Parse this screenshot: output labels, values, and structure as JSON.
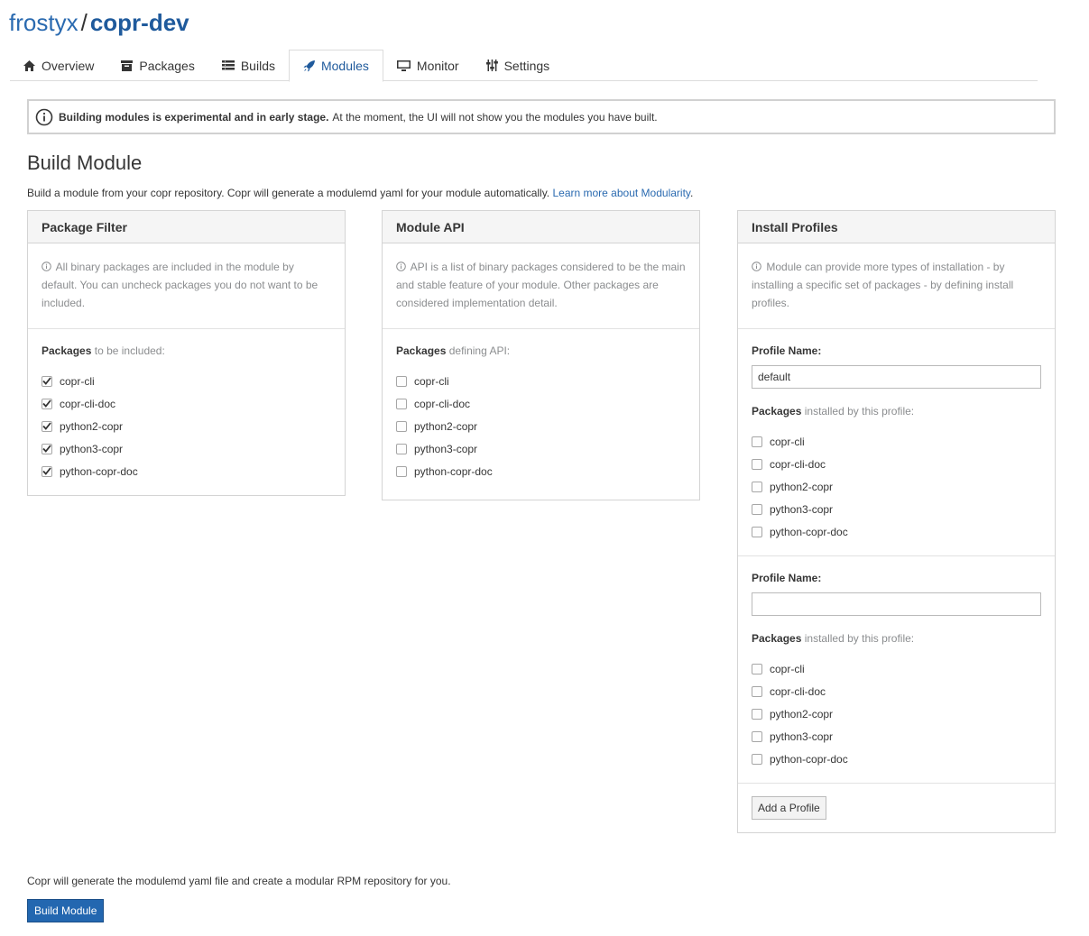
{
  "header": {
    "owner": "frostyx",
    "separator": "/",
    "project": "copr-dev"
  },
  "tabs": [
    {
      "label": "Overview",
      "icon": "home-icon"
    },
    {
      "label": "Packages",
      "icon": "archive-icon"
    },
    {
      "label": "Builds",
      "icon": "list-icon"
    },
    {
      "label": "Modules",
      "icon": "rocket-icon",
      "active": true
    },
    {
      "label": "Monitor",
      "icon": "monitor-icon"
    },
    {
      "label": "Settings",
      "icon": "sliders-icon"
    }
  ],
  "alert": {
    "bold": "Building modules is experimental and in early stage.",
    "text": "At the moment, the UI will not show you the modules you have built."
  },
  "page": {
    "title": "Build Module",
    "intro": "Build a module from your copr repository. Copr will generate a modulemd yaml for your module automatically.",
    "intro_link": "Learn more about Modularity",
    "intro_end": "."
  },
  "filter": {
    "title": "Package Filter",
    "desc": "All binary packages are included in the module by default. You can uncheck packages you do not want to be included.",
    "label_bold": "Packages",
    "label_rest": "to be included:",
    "packages": [
      "copr-cli",
      "copr-cli-doc",
      "python2-copr",
      "python3-copr",
      "python-copr-doc"
    ]
  },
  "api": {
    "title": "Module API",
    "desc": "API is a list of binary packages considered to be the main and stable feature of your module. Other packages are considered implementation detail.",
    "label_bold": "Packages",
    "label_rest": "defining API:",
    "packages": [
      "copr-cli",
      "copr-cli-doc",
      "python2-copr",
      "python3-copr",
      "python-copr-doc"
    ]
  },
  "profiles": {
    "title": "Install Profiles",
    "desc": "Module can provide more types of installation - by installing a specific set of packages - by defining install profiles.",
    "name_label": "Profile Name:",
    "label_bold": "Packages",
    "label_rest": "installed by this profile:",
    "profile1_name": "default",
    "profile2_name": "",
    "packages": [
      "copr-cli",
      "copr-cli-doc",
      "python2-copr",
      "python3-copr",
      "python-copr-doc"
    ],
    "add_button": "Add a Profile"
  },
  "footer": {
    "text": "Copr will generate the modulemd yaml file and create a modular RPM repository for you.",
    "submit": "Build Module"
  },
  "colors": {
    "link": "#2a6ab0",
    "primary": "#2367b0"
  }
}
